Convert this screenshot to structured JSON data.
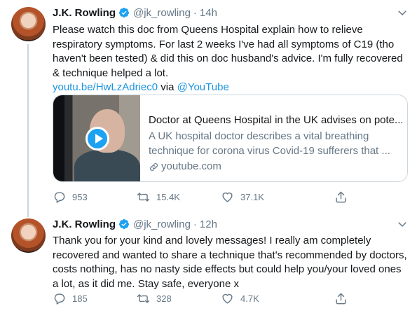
{
  "tweets": [
    {
      "name": "J.K. Rowling",
      "handle": "@jk_rowling",
      "separator": "·",
      "time": "14h",
      "text_lines": [
        "Please watch this doc from Queens Hospital explain how to relieve",
        "respiratory symptoms. For last 2 weeks I've had all symptoms of C19 (tho",
        "haven't been tested) & did this on doc husband's advice. I'm fully recovered",
        "& technique helped a lot."
      ],
      "link_text": "youtu.be/HwLzAdriec0",
      "via_text": " via ",
      "mention_text": "@YouTube",
      "card": {
        "title": "Doctor at Queens Hospital in the UK advises on pote...",
        "description_lines": [
          "A UK hospital doctor describes a vital breathing",
          "technique for corona virus Covid-19 sufferers that ..."
        ],
        "domain": "youtube.com"
      },
      "replies": "953",
      "retweets": "15.4K",
      "likes": "37.1K"
    },
    {
      "name": "J.K. Rowling",
      "handle": "@jk_rowling",
      "separator": "·",
      "time": "12h",
      "text_lines": [
        "Thank you for your kind and lovely messages! I really am completely",
        "recovered and wanted to share a technique that's recommended by doctors,",
        "costs nothing, has no nasty side effects but could help you/your loved ones",
        "a lot, as it did me. Stay safe, everyone x"
      ],
      "replies": "185",
      "retweets": "328",
      "likes": "4.7K"
    }
  ],
  "colors": {
    "link": "#1b95e0",
    "secondary_text": "#657786",
    "verified": "#1da1f2"
  },
  "icons": [
    "verified-badge-icon",
    "chevron-down-icon",
    "reply-icon",
    "retweet-icon",
    "like-icon",
    "share-icon",
    "link-icon",
    "play-icon"
  ]
}
